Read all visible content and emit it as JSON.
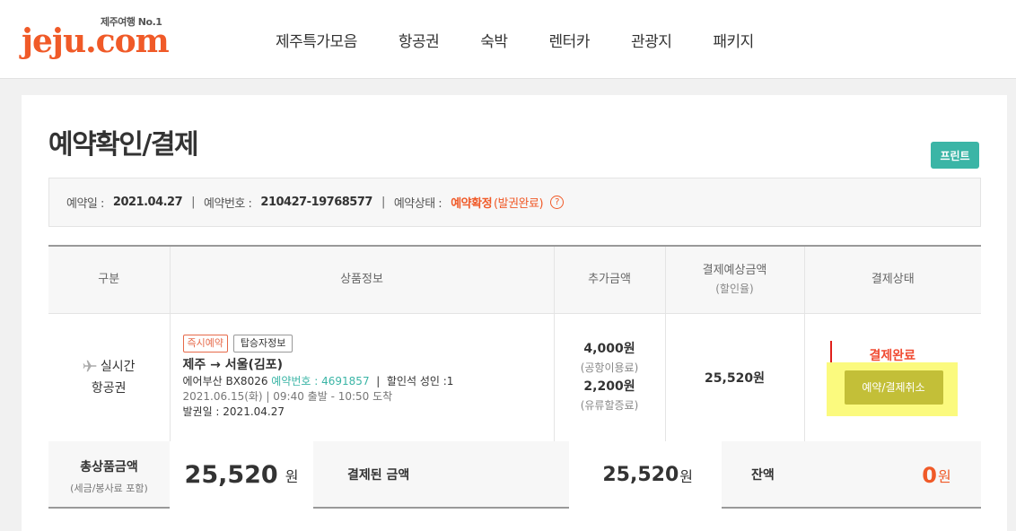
{
  "header": {
    "logo_text": "jeju.com",
    "logo_tagline": "제주여행 No.1",
    "nav": [
      "제주특가모음",
      "항공권",
      "숙박",
      "렌터카",
      "관광지",
      "패키지"
    ]
  },
  "page": {
    "title": "예약확인/결제",
    "print_label": "프린트"
  },
  "reservation_info": {
    "date_label": "예약일 :",
    "date": "2021.04.27",
    "number_label": "예약번호 :",
    "number": "210427-19768577",
    "status_label": "예약상태 :",
    "status": "예약확정",
    "status_detail": "(발권완료)",
    "help_icon": "?"
  },
  "table": {
    "headers": {
      "category": "구분",
      "product": "상품정보",
      "extra": "추가금액",
      "expected": "결제예상금액",
      "expected_sub": "(할인율)",
      "status": "결제상태"
    },
    "row": {
      "category_line1": "실시간",
      "category_line2": "항공권",
      "tag_instant": "즉시예약",
      "tag_passenger": "탑승자정보",
      "route": "제주 → 서울(김포)",
      "airline": "에어부산 BX8026",
      "booking_label": "예약번호 : 4691857",
      "seat_info": "할인석 성인 :1",
      "schedule": "2021.06.15(화)  |  09:40 출발 - 10:50 도착",
      "issue_date": "발권일 : 2021.04.27",
      "extra_amount1": "4,000원",
      "extra_label1": "(공항이용료)",
      "extra_amount2": "2,200원",
      "extra_label2": "(유류할증료)",
      "expected_amount": "25,520원",
      "payment_status": "결제완료",
      "cancel_label": "예약/결제취소"
    }
  },
  "totals": {
    "total_label": "총상품금액",
    "total_sub": "(세금/봉사료 포함)",
    "total_amount": "25,520",
    "total_unit": "원",
    "paid_label": "결제된 금액",
    "paid_amount": "25,520",
    "paid_unit": "원",
    "balance_label": "잔액",
    "balance_amount": "0",
    "balance_unit": "원"
  },
  "colors": {
    "brand": "#f05a28",
    "teal": "#3bb5a6",
    "highlight": "#fbfa7e",
    "cancel_button": "#c3bf38"
  }
}
